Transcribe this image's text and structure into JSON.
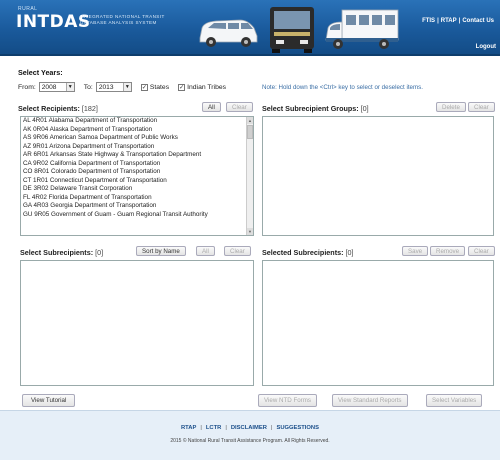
{
  "header": {
    "rural": "RURAL",
    "logo": "INTDAS",
    "logo_sub_1": "INTEGRATED NATIONAL TRANSIT",
    "logo_sub_2": "DATABASE ANALYSIS SYSTEM",
    "link_ftis": "FTIS",
    "link_rtap": "RTAP",
    "link_contact": "Contact Us",
    "logout": "Logout"
  },
  "years": {
    "title": "Select Years:",
    "from_label": "From:",
    "from_value": "2008",
    "to_label": "To:",
    "to_value": "2013",
    "states_label": "States",
    "tribes_label": "Indian Tribes",
    "note": "Note: Hold down the <Ctrl> key to select or deselect items."
  },
  "recipients": {
    "title": "Select Recipients:",
    "count": "[182]",
    "all_label": "All",
    "clear_label": "Clear",
    "items": [
      "AL 4R01 Alabama Department of Transportation",
      "AK 0R04 Alaska Department of Transportation",
      "AS 9R06 American Samoa Department of Public Works",
      "AZ 9R01 Arizona Department of Transportation",
      "AR 6R01 Arkansas State Highway & Transportation Department",
      "CA 9R02 California Department of Transportation",
      "CO 8R01 Colorado Department of Transportation",
      "CT 1R01 Connecticut Department of Transportation",
      "DE 3R02 Delaware Transit Corporation",
      "FL 4R02 Florida Department of Transportation",
      "GA 4R03 Georgia Department of Transportation",
      "GU 9R05 Government of Guam - Guam Regional Transit Authority"
    ]
  },
  "subrecipient_groups": {
    "title": "Select Subrecipient Groups:",
    "count": "[0]",
    "delete_label": "Delete",
    "clear_label": "Clear"
  },
  "subrecipients": {
    "title": "Select Subrecipients:",
    "count": "[0]",
    "sort_label": "Sort by Name",
    "all_label": "All",
    "clear_label": "Clear"
  },
  "selected": {
    "title": "Selected Subrecipients:",
    "count": "[0]",
    "save_label": "Save",
    "remove_label": "Remove",
    "clear_label": "Clear"
  },
  "bottom_buttons": {
    "tutorial": "View Tutorial",
    "ntd_forms": "View NTD Forms",
    "standard_reports": "View Standard Reports",
    "select_variables": "Select Variables"
  },
  "footer": {
    "links": [
      "RTAP",
      "LCTR",
      "DISCLAIMER",
      "SUGGESTIONS"
    ],
    "copyright": "2015 © National Rural Transit Assistance Program. All Rights Reserved."
  }
}
